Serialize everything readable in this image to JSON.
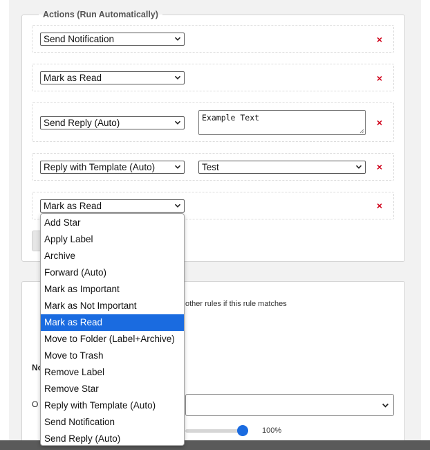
{
  "actions": {
    "legend": "Actions (Run Automatically)",
    "rows": [
      {
        "action": "Send Notification"
      },
      {
        "action": "Mark as Read"
      },
      {
        "action": "Send Reply (Auto)",
        "text_value": "Example Text"
      },
      {
        "action": "Reply with Template (Auto)",
        "template": "Test"
      },
      {
        "action": "Mark as Read"
      }
    ],
    "remove_symbol": "×"
  },
  "dropdown": {
    "selected": "Mark as Read",
    "options": [
      "Add Star",
      "Apply Label",
      "Archive",
      "Forward (Auto)",
      "Mark as Important",
      "Mark as Not Important",
      "Mark as Read",
      "Move to Folder (Label+Archive)",
      "Move to Trash",
      "Remove Label",
      "Remove Star",
      "Reply with Template (Auto)",
      "Send Notification",
      "Send Reply (Auto)"
    ]
  },
  "settings": {
    "stop_text": "other rules if this rule matches",
    "partial_label": "No",
    "partial_label_2": "O",
    "slider_percent": 100,
    "slider_value": "100%"
  },
  "icons": {
    "chevron": "chevron-down-icon",
    "remove": "close-icon"
  },
  "colors": {
    "accent": "#1a6be0",
    "remove": "#d0021b"
  }
}
